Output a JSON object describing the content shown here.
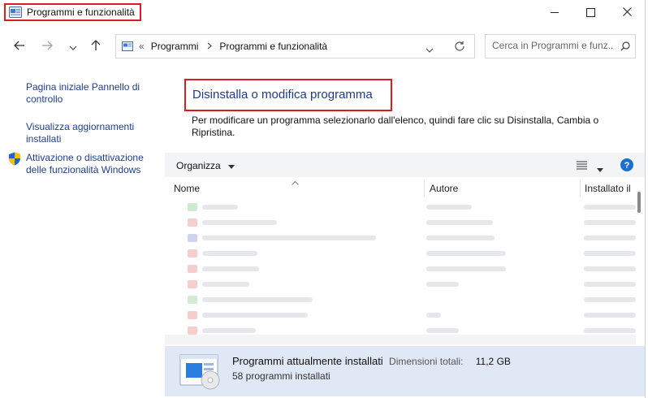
{
  "window": {
    "title": "Programmi e funzionalità"
  },
  "navbar": {
    "breadcrumb_prefix": "«",
    "breadcrumb": [
      "Programmi",
      "Programmi e funzionalità"
    ],
    "search_placeholder": "Cerca in Programmi e funz..."
  },
  "sidebar": {
    "items": [
      {
        "label": "Pagina iniziale Pannello di controllo"
      },
      {
        "label": "Visualizza aggiornamenti installati"
      },
      {
        "label": "Attivazione o disattivazione delle funzionalità Windows"
      }
    ]
  },
  "main": {
    "title": "Disinstalla o modifica programma",
    "description": "Per modificare un programma selezionarlo dall'elenco, quindi fare clic su Disinstalla, Cambia o Ripristina."
  },
  "toolbar": {
    "organize_label": "Organizza"
  },
  "table": {
    "columns": [
      "Nome",
      "Autore",
      "Installato il"
    ]
  },
  "status": {
    "title": "Programmi attualmente installati",
    "size_label": "Dimensioni totali:",
    "size_value": "11,2 GB",
    "count": "58 programmi installati"
  },
  "colors": {
    "accent_red": "#d81e1e",
    "link_blue": "#1f3e8a",
    "status_bg": "#dfe8f4",
    "help_blue": "#1a6fd1"
  }
}
